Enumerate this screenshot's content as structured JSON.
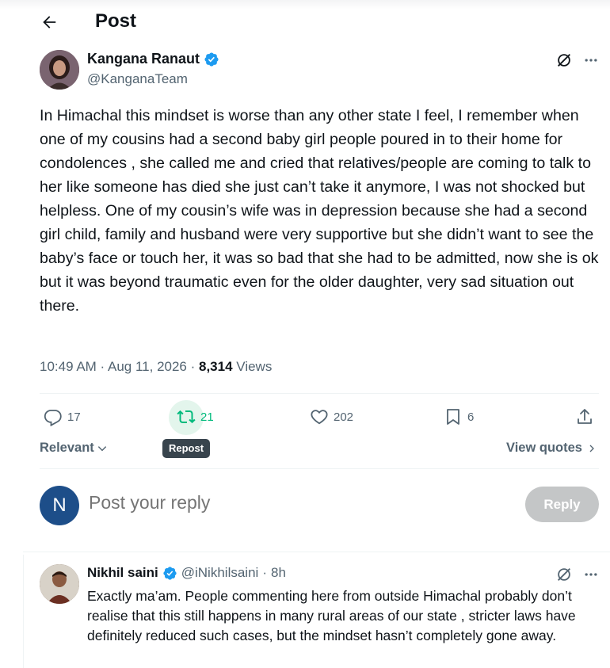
{
  "header": {
    "title": "Post"
  },
  "post": {
    "author_name": "Kangana Ranaut",
    "author_handle": "@KanganaTeam",
    "text": "In Himachal this mindset is worse than any other state I feel, I remember when one of my cousins had a second baby girl people poured in to their home for condolences , she called me and cried that relatives/people are coming to talk to her like someone has died she just can’t take it anymore, I was not shocked but helpless. One of my cousin’s wife was in depression because she had a second girl child, family and husband were very supportive but she didn’t want to see the baby’s face or touch her, it was so bad that she had to be admitted, now she is ok but it was beyond traumatic even for the older daughter, very sad situation out there.",
    "time": "10:49 AM",
    "date": "Aug 11, 2026",
    "views_count": "8,314",
    "views_label": "Views"
  },
  "actions": {
    "replies": "17",
    "reposts": "21",
    "likes": "202",
    "bookmarks": "6",
    "repost_tooltip": "Repost"
  },
  "sort": {
    "label": "Relevant",
    "view_quotes": "View quotes"
  },
  "composer": {
    "avatar_letter": "N",
    "placeholder": "Post your reply",
    "button": "Reply"
  },
  "reply": {
    "name": "Nikhil saini",
    "handle": "@iNikhilsaini",
    "time": "8h",
    "text": "Exactly ma’am. People commenting here from outside Himachal probably don’t realise that this still happens in many rural areas of our state , stricter laws have definitely reduced such cases, but the mindset hasn’t completely gone away."
  },
  "colors": {
    "verified": "#1d9bf0",
    "repost_active": "#00ba7c",
    "text_secondary": "#536471"
  }
}
